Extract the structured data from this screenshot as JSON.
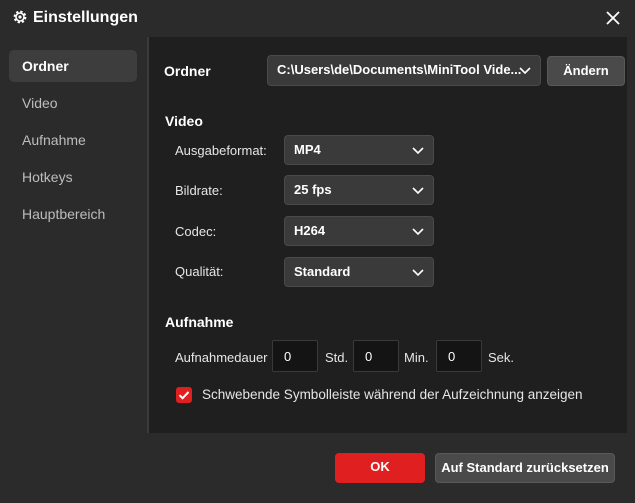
{
  "window": {
    "title": "Einstellungen"
  },
  "sidebar": {
    "items": [
      {
        "label": "Ordner",
        "active": true
      },
      {
        "label": "Video",
        "active": false
      },
      {
        "label": "Aufnahme",
        "active": false
      },
      {
        "label": "Hotkeys",
        "active": false
      },
      {
        "label": "Hauptbereich",
        "active": false
      }
    ]
  },
  "folder": {
    "label": "Ordner",
    "path": "C:\\Users\\de\\Documents\\MiniTool Vide...",
    "change_label": "Ändern"
  },
  "video": {
    "heading": "Video",
    "format_label": "Ausgabeformat:",
    "format_value": "MP4",
    "framerate_label": "Bildrate:",
    "framerate_value": "25 fps",
    "codec_label": "Codec:",
    "codec_value": "H264",
    "quality_label": "Qualität:",
    "quality_value": "Standard"
  },
  "recording": {
    "heading": "Aufnahme",
    "duration_label": "Aufnahmedauer",
    "hours_value": "0",
    "hours_unit": "Std.",
    "minutes_value": "0",
    "minutes_unit": "Min.",
    "seconds_value": "0",
    "seconds_unit": "Sek.",
    "toolbar_checkbox_label": "Schwebende Symbolleiste während der Aufzeichnung anzeigen",
    "toolbar_checkbox_checked": true
  },
  "footer": {
    "ok_label": "OK",
    "reset_label": "Auf Standard zurücksetzen"
  },
  "colors": {
    "accent": "#e02020",
    "background": "#2b2b2b",
    "content_background": "#1f1f1f"
  }
}
